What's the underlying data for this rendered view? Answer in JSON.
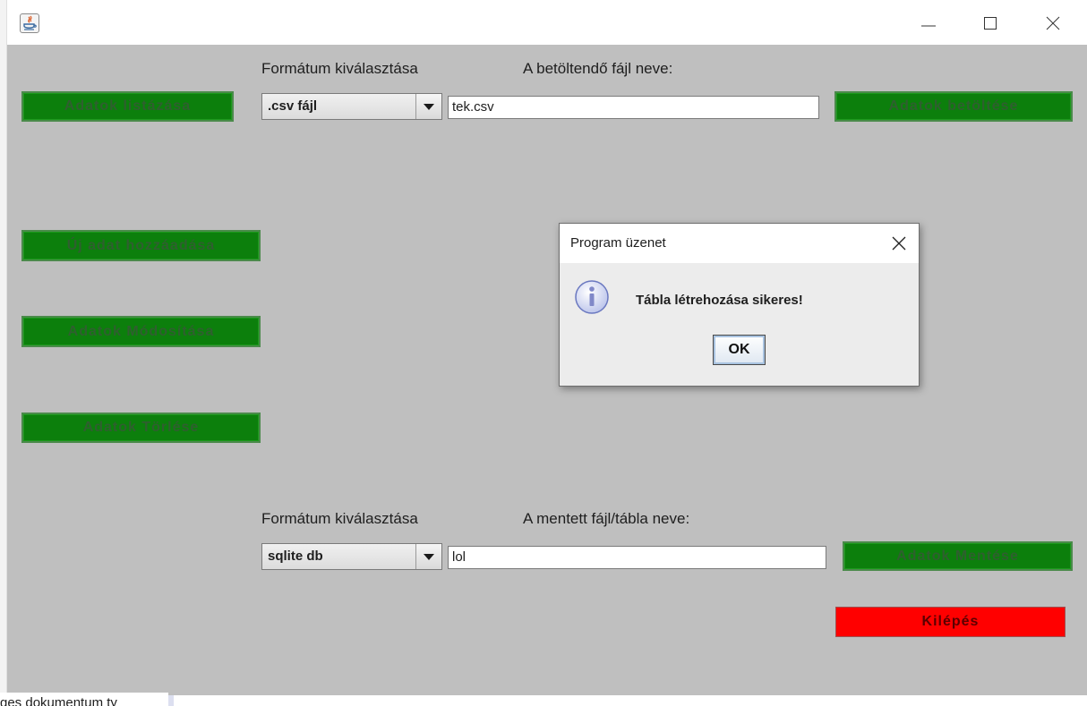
{
  "window": {
    "minimize_glyph": "—",
    "maximize_glyph": "☐",
    "close_glyph": "✕"
  },
  "buttons": {
    "list_data": "Adatok listázása",
    "load_data": "Adatok betöltése",
    "add_new": "Új adat hozzáadása",
    "modify_data": "Adatok Módosítása",
    "delete_data": "Adatok Törlése",
    "save_data": "Adatok Mentése",
    "exit": "Kilépés"
  },
  "load_section": {
    "format_label": "Formátum kiválasztása",
    "file_label": "A betöltendő fájl neve:",
    "format_value": ".csv fájl",
    "file_value": "tek.csv"
  },
  "save_section": {
    "format_label": "Formátum kiválasztása",
    "file_label": "A mentett fájl/tábla neve:",
    "format_value": "sqlite db",
    "file_value": "lol"
  },
  "dialog": {
    "title": "Program üzenet",
    "message": "Tábla létrehozása sikeres!",
    "ok_label": "OK"
  },
  "background": {
    "taskbar_text": "ges dokumentum ty"
  },
  "colors": {
    "panel_bg": "#bfbfbf",
    "green_button": "#0c7f0c",
    "exit_button": "#ff0000"
  }
}
